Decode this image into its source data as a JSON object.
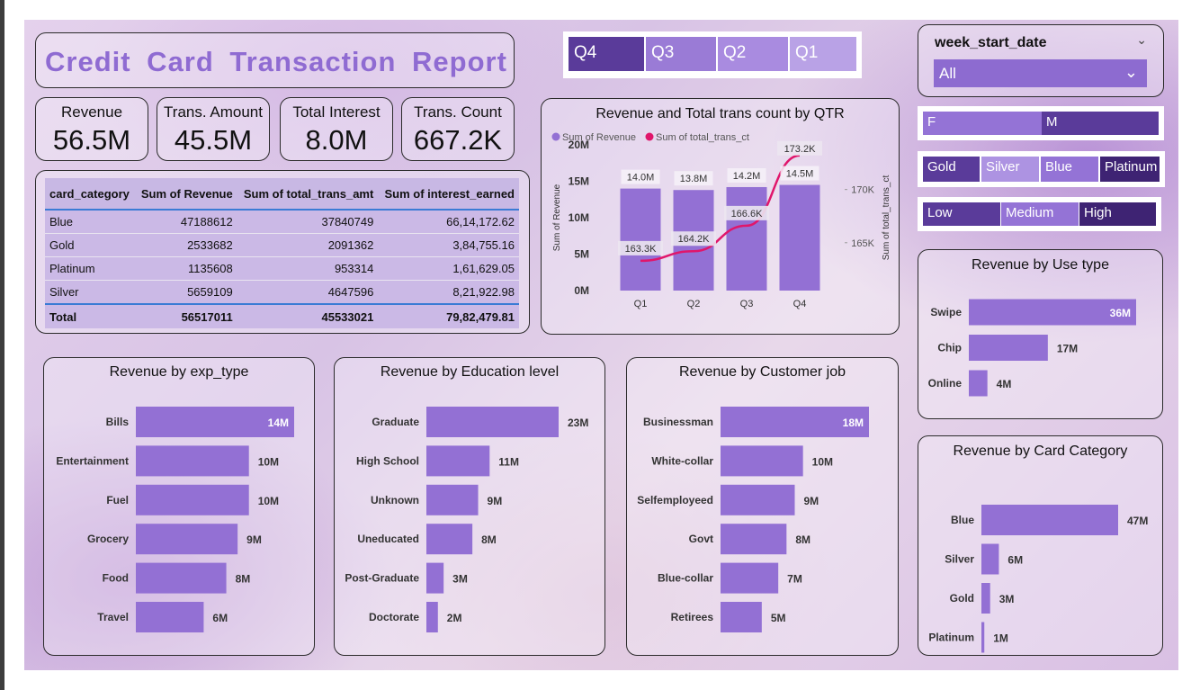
{
  "title": "Credit Card Transaction Report",
  "kpis": [
    {
      "label": "Revenue",
      "value": "56.5M"
    },
    {
      "label": "Trans. Amount",
      "value": "45.5M"
    },
    {
      "label": "Total Interest",
      "value": "8.0M"
    },
    {
      "label": "Trans. Count",
      "value": "667.2K"
    }
  ],
  "quarter_slicer": [
    "Q4",
    "Q3",
    "Q2",
    "Q1"
  ],
  "week_slicer": {
    "label": "week_start_date",
    "value": "All"
  },
  "gender_slicer": [
    "F",
    "M"
  ],
  "card_slicer": [
    "Gold",
    "Silver",
    "Blue",
    "Platinum"
  ],
  "income_slicer": [
    "Low",
    "Medium",
    "High"
  ],
  "summary_table": {
    "headers": [
      "card_category",
      "Sum of Revenue",
      "Sum of total_trans_amt",
      "Sum of interest_earned"
    ],
    "rows": [
      [
        "Blue",
        "47188612",
        "37840749",
        "66,14,172.62"
      ],
      [
        "Gold",
        "2533682",
        "2091362",
        "3,84,755.16"
      ],
      [
        "Platinum",
        "1135608",
        "953314",
        "1,61,629.05"
      ],
      [
        "Silver",
        "5659109",
        "4647596",
        "8,21,922.98"
      ]
    ],
    "total": [
      "Total",
      "56517011",
      "45533021",
      "79,82,479.81"
    ]
  },
  "colors": {
    "bar": "#9370d4",
    "line": "#e0166b",
    "dark": "#4a2d8a",
    "accent": "#3a7bd5"
  },
  "chart_data": [
    {
      "type": "bar",
      "title": "Revenue and Total trans count by QTR",
      "legend": [
        "Sum of Revenue",
        "Sum of total_trans_ct"
      ],
      "legend_position": "top-left",
      "categories": [
        "Q1",
        "Q2",
        "Q3",
        "Q4"
      ],
      "series": [
        {
          "name": "Sum of Revenue",
          "type": "bar",
          "values": [
            14.0,
            13.8,
            14.2,
            14.5
          ],
          "labels": [
            "14.0M",
            "13.8M",
            "14.2M",
            "14.5M"
          ]
        },
        {
          "name": "Sum of total_trans_ct",
          "type": "line",
          "values": [
            163.3,
            164.2,
            166.6,
            173.2
          ],
          "labels": [
            "163.3K",
            "164.2K",
            "166.6K",
            "173.2K"
          ]
        }
      ],
      "ylabel": "Sum of Revenue",
      "y2label": "Sum of total_trans_ct",
      "yticks": [
        "20M",
        "15M",
        "10M",
        "5M",
        "0M"
      ],
      "ylim": [
        0,
        20
      ],
      "y2ticks": [
        "170K",
        "165K"
      ],
      "y2lim": [
        160.5,
        174.2
      ]
    },
    {
      "type": "bar",
      "orientation": "horizontal",
      "title": "Revenue by Use type",
      "categories": [
        "Swipe",
        "Chip",
        "Online"
      ],
      "values": [
        36,
        17,
        4
      ],
      "labels": [
        "36M",
        "17M",
        "4M"
      ]
    },
    {
      "type": "bar",
      "orientation": "horizontal",
      "title": "Revenue by exp_type",
      "categories": [
        "Bills",
        "Entertainment",
        "Fuel",
        "Grocery",
        "Food",
        "Travel"
      ],
      "values": [
        14,
        10,
        10,
        9,
        8,
        6
      ],
      "labels": [
        "14M",
        "10M",
        "10M",
        "9M",
        "8M",
        "6M"
      ]
    },
    {
      "type": "bar",
      "orientation": "horizontal",
      "title": "Revenue by Education level",
      "categories": [
        "Graduate",
        "High School",
        "Unknown",
        "Uneducated",
        "Post-Graduate",
        "Doctorate"
      ],
      "values": [
        23,
        11,
        9,
        8,
        3,
        2
      ],
      "labels": [
        "23M",
        "11M",
        "9M",
        "8M",
        "3M",
        "2M"
      ]
    },
    {
      "type": "bar",
      "orientation": "horizontal",
      "title": "Revenue by Customer job",
      "categories": [
        "Businessman",
        "White-collar",
        "Selfemployeed",
        "Govt",
        "Blue-collar",
        "Retirees"
      ],
      "values": [
        18,
        10,
        9,
        8,
        7,
        5
      ],
      "labels": [
        "18M",
        "10M",
        "9M",
        "8M",
        "7M",
        "5M"
      ]
    },
    {
      "type": "bar",
      "orientation": "horizontal",
      "title": "Revenue by Card Category",
      "categories": [
        "Blue",
        "Silver",
        "Gold",
        "Platinum"
      ],
      "values": [
        47,
        6,
        3,
        1
      ],
      "labels": [
        "47M",
        "6M",
        "3M",
        "1M"
      ]
    }
  ]
}
